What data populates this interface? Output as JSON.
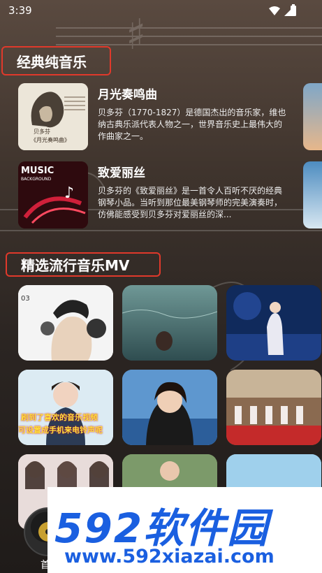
{
  "status_bar": {
    "time": "3:39"
  },
  "section_classic": {
    "title": "经典纯音乐"
  },
  "tracks": [
    {
      "name": "月光奏鸣曲",
      "desc": "贝多芬（1770-1827）是德国杰出的音乐家，维也纳古典乐派代表人物之一，世界音乐史上最伟大的作曲家之一。",
      "thumb_text_1": "贝多芬",
      "thumb_text_2": "《月光奏鸣曲》"
    },
    {
      "name": "致爱丽丝",
      "desc": "贝多芬的《致爱丽丝》是一首令人百听不厌的经典钢琴小品。当听到那位最美钢琴师的完美演奏时，仿佛能感受到贝多芬对爱丽丝的深...",
      "thumb_text_1": "MUSIC",
      "thumb_text_2": "BACKGROUND"
    }
  ],
  "section_mv": {
    "title": "精选流行音乐MV"
  },
  "mv_overlays": {
    "mv1_corner": "03",
    "mv5_line1": "刷到了喜欢的音乐视频",
    "mv5_line2": "可设置成手机来电铃声呢"
  },
  "bottom_nav": {
    "label": "首"
  },
  "watermark": {
    "brand": "592软件园",
    "url": "www.592xiazai.com"
  },
  "colors": {
    "highlight_border": "#e0392b",
    "watermark_blue": "#1a5fe0"
  }
}
